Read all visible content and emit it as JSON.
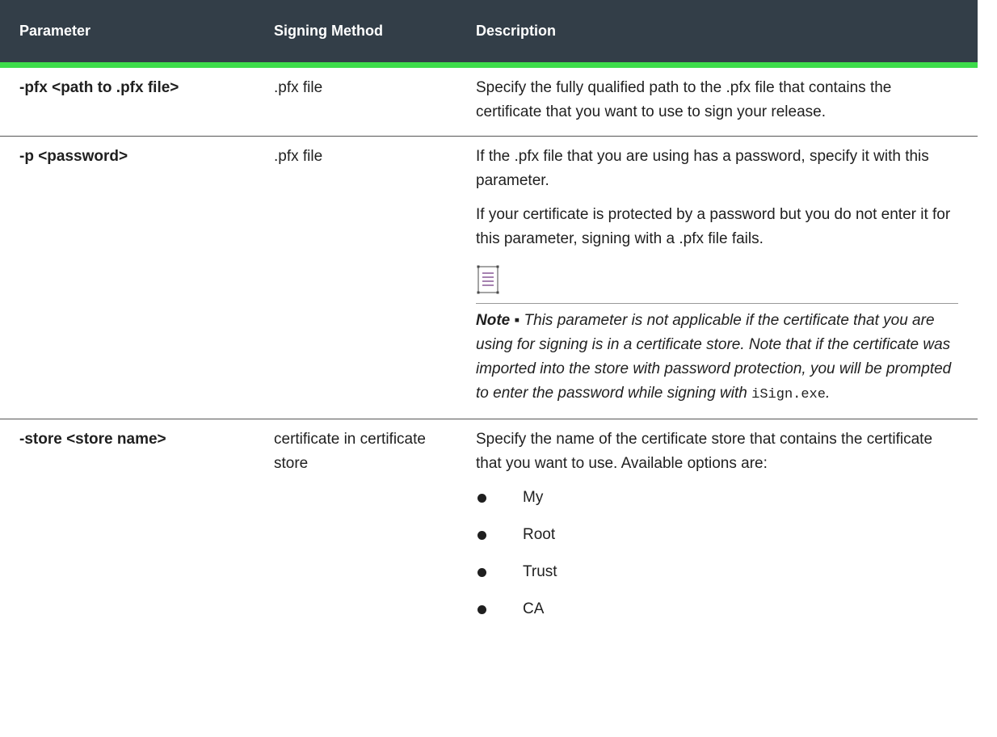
{
  "table": {
    "headers": {
      "parameter": "Parameter",
      "signing_method": "Signing Method",
      "description": "Description"
    },
    "rows": [
      {
        "parameter": "-pfx <path to .pfx file>",
        "signing_method": ".pfx file",
        "description": [
          "Specify the fully qualified path to the .pfx file that contains the certificate that you want to use to sign your release."
        ]
      },
      {
        "parameter": "-p <password>",
        "signing_method": ".pfx file",
        "description": [
          "If the .pfx file that you are using has a password, specify it with this parameter.",
          "If your certificate is protected by a password but you do not enter it for this parameter, signing with a .pfx file fails."
        ],
        "note": {
          "icon": "note-icon",
          "label": "Note ▪",
          "text": " This parameter is not applicable if the certificate that you are using for signing is in a certificate store. Note that if the certificate was imported into the store with password protection, you will be prompted to enter the password while signing with ",
          "code": "iSign.exe",
          "end": "."
        }
      },
      {
        "parameter": "-store <store name>",
        "signing_method": "certificate in certificate store",
        "description": [
          "Specify the name of the certificate store that contains the certificate that you want to use. Available options are:"
        ],
        "options": [
          "My",
          "Root",
          "Trust",
          "CA"
        ]
      }
    ]
  },
  "colors": {
    "header_bg": "#333e48",
    "header_accent": "#3ddc4a",
    "note_icon": "#6b2f7d"
  }
}
